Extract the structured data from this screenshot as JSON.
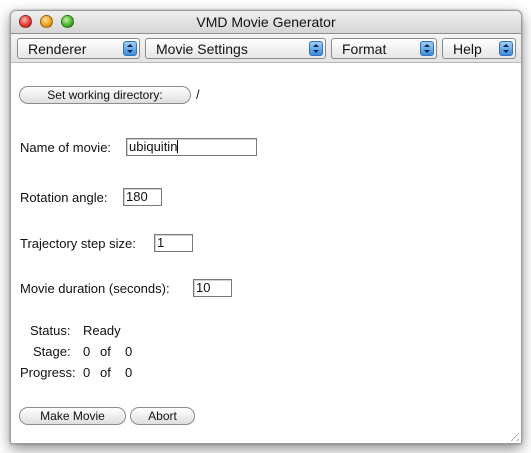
{
  "window": {
    "title": "VMD Movie Generator"
  },
  "menus": [
    {
      "label": "Renderer"
    },
    {
      "label": "Movie Settings"
    },
    {
      "label": "Format"
    },
    {
      "label": "Help"
    }
  ],
  "working_dir": {
    "button_label": "Set working directory:",
    "value": "/"
  },
  "fields": {
    "movie_name": {
      "label": "Name of movie:",
      "value": "ubiquitin"
    },
    "rotation_angle": {
      "label": "Rotation angle:",
      "value": "180"
    },
    "trajectory_step": {
      "label": "Trajectory step size:",
      "value": "1"
    },
    "duration": {
      "label": "Movie duration (seconds):",
      "value": "10"
    }
  },
  "status": {
    "status_label": "Status:",
    "status_value": "Ready",
    "stage_label": "Stage:",
    "stage_current": "0",
    "stage_of": "of",
    "stage_total": "0",
    "progress_label": "Progress:",
    "progress_current": "0",
    "progress_of": "of",
    "progress_total": "0"
  },
  "actions": {
    "make_movie": "Make Movie",
    "abort": "Abort"
  }
}
